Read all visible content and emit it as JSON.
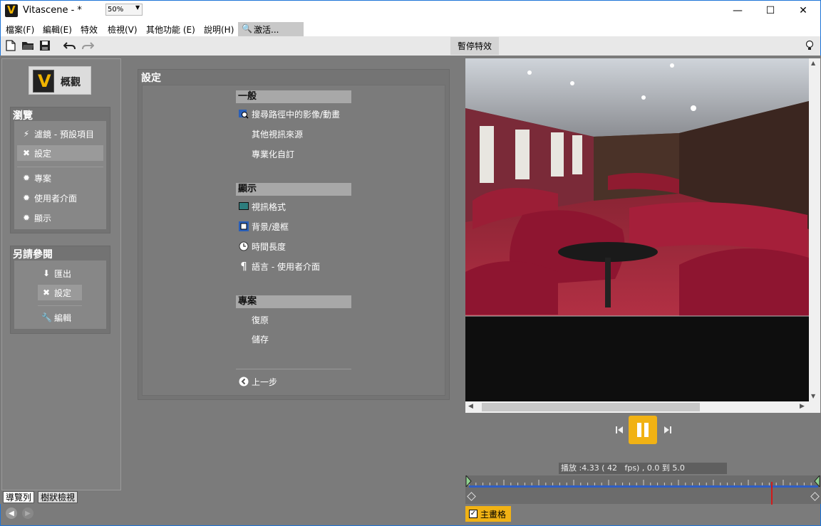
{
  "window": {
    "title": "Vitascene - *",
    "logo_letter": "V",
    "minimize": "—",
    "maximize": "☐",
    "close": "✕"
  },
  "menu": {
    "items": [
      "檔案(F)",
      "編輯(E)",
      "特效",
      "檢視(V)",
      "其他功能 (E)",
      "說明(H)"
    ],
    "activate_label": "激活..."
  },
  "toolbar": {
    "zoom_value": "50%",
    "pause_effects_label": "暫停特效"
  },
  "nav": {
    "overview_label": "概觀",
    "browse": {
      "title": "瀏覽",
      "items": [
        {
          "label": "濾鏡 - 預設項目",
          "icon": "lightning-icon"
        },
        {
          "label": "設定",
          "icon": "tools-icon"
        },
        {
          "label": "專案",
          "icon": "gear-icon"
        },
        {
          "label": "使用者介面",
          "icon": "gear-icon"
        },
        {
          "label": "顯示",
          "icon": "gear-icon"
        }
      ]
    },
    "see_also": {
      "title": "另請參閱",
      "items": [
        {
          "label": "匯出",
          "icon": "download-icon"
        },
        {
          "label": "設定",
          "icon": "tools-icon"
        },
        {
          "label": "編輯",
          "icon": "wrench-icon"
        }
      ]
    },
    "tabs": [
      "導覽列",
      "樹狀檢視"
    ]
  },
  "settings": {
    "title": "設定",
    "general": {
      "header": "一般",
      "items": [
        "搜尋路徑中的影像/動畫",
        "其他視訊來源",
        "專業化自訂"
      ]
    },
    "display": {
      "header": "顯示",
      "items": [
        "視訊格式",
        "背景/邊框",
        "時間長度",
        "語言 - 使用者介面"
      ]
    },
    "project": {
      "header": "專案",
      "items": [
        "復原",
        "儲存"
      ]
    },
    "back_label": "上一步"
  },
  "player": {
    "play_info": "播放 :4.33 ( 42   fps) , 0.0 到 5.0",
    "playhead_fraction": 0.866,
    "main_board_label": "主畫格",
    "main_board_checked": true
  },
  "colors": {
    "accent": "#f1b214",
    "timeline_track": "#2f5ec4",
    "playhead": "#d21a1a",
    "window_border": "#1e74d8"
  }
}
